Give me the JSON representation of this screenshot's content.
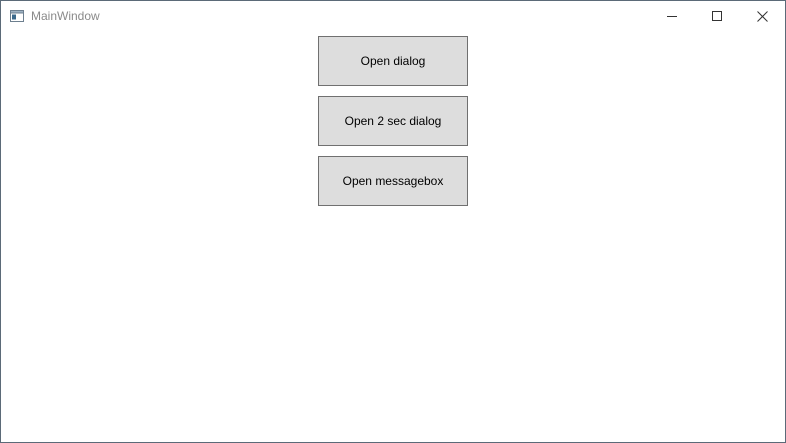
{
  "window": {
    "title": "MainWindow",
    "icon": "app-window-icon",
    "caption_buttons": [
      "minimize-icon",
      "maximize-icon",
      "close-icon"
    ]
  },
  "buttons": {
    "open_dialog": "Open dialog",
    "open_2sec_dialog": "Open 2 sec dialog",
    "open_messagebox": "Open messagebox"
  },
  "colors": {
    "button_bg": "#dddddd",
    "button_border": "#707070",
    "title_text": "#8a8a8a",
    "window_border": "#5b6a78"
  }
}
